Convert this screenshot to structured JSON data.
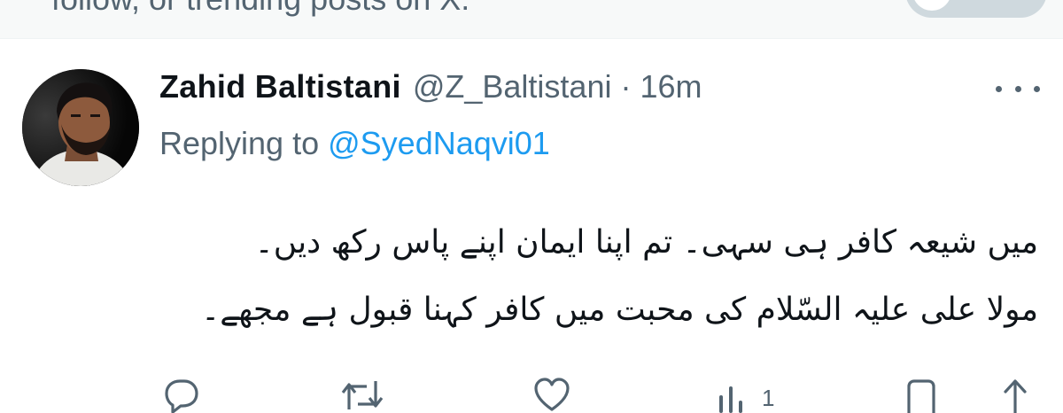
{
  "banner": {
    "text": "follow, or trending posts on X."
  },
  "tweet": {
    "display_name": "Zahid Baltistani",
    "handle": "@Z_Baltistani",
    "separator": "·",
    "timestamp": "16m",
    "replying_prefix": "Replying to ",
    "replying_handle": "@SyedNaqvi01",
    "body_lines": [
      "میں شیعہ کافر ہی سہی۔ تم اپنا ایمان اپنے پاس رکھ دیں۔",
      "مولا علی علیہ السّلام کی محبت میں کافر کہنا قبول ہے مجھے۔"
    ]
  },
  "actions": {
    "views_count": "1"
  },
  "icons": {
    "more": "more-horizontal-icon",
    "reply": "reply-icon",
    "retweet": "retweet-icon",
    "like": "heart-icon",
    "views": "views-icon",
    "bookmark": "bookmark-icon",
    "share": "share-icon"
  },
  "colors": {
    "link": "#1d9bf0",
    "secondary_text": "#536471",
    "primary_text": "#0f1419"
  }
}
